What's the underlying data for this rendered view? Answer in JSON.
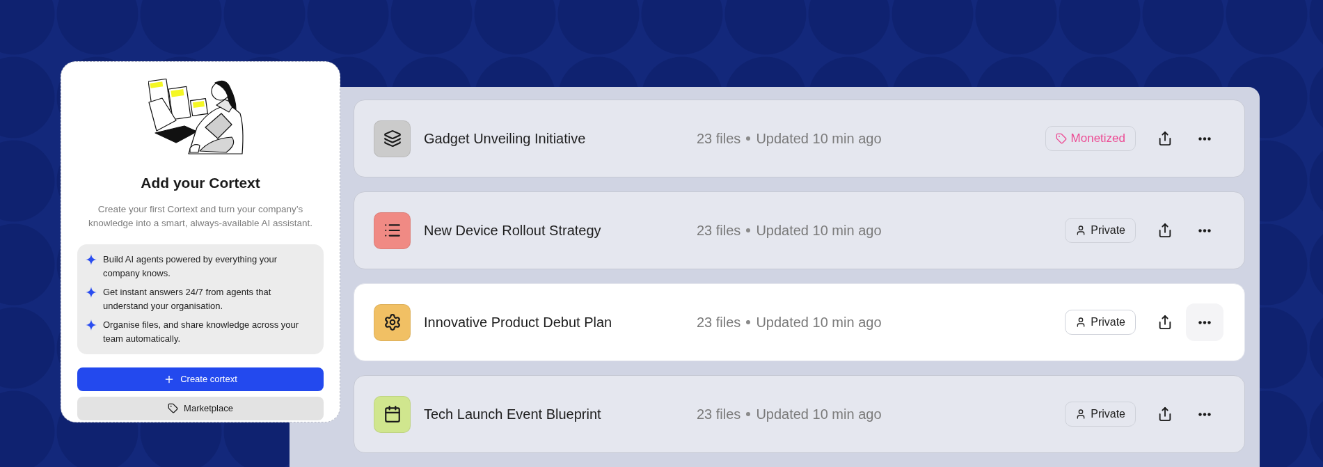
{
  "intro_card": {
    "title": "Add your Cortext",
    "description": "Create your first Cortext and turn your company’s knowledge into a smart, always-available AI assistant.",
    "features": [
      "Build AI agents powered by everything your company knows.",
      "Get instant answers 24/7 from agents that understand your organisation.",
      "Organise files, and share knowledge across your team automatically."
    ],
    "primary_button": "Create cortext",
    "secondary_button": "Marketplace"
  },
  "cortexts": [
    {
      "name": "Gadget Unveiling Initiative",
      "kind": "layers",
      "color": "#cbcbcb",
      "files": "23 files",
      "updated": "Updated 10 min ago",
      "badge": {
        "kind": "monetized",
        "label": "Monetized"
      },
      "selected": false
    },
    {
      "name": "New Device Rollout Strategy",
      "kind": "list",
      "color": "#f08a84",
      "files": "23 files",
      "updated": "Updated 10 min ago",
      "badge": {
        "kind": "private",
        "label": "Private"
      },
      "selected": false
    },
    {
      "name": "Innovative Product Debut Plan",
      "kind": "gear",
      "color": "#f1c064",
      "files": "23 files",
      "updated": "Updated 10 min ago",
      "badge": {
        "kind": "private",
        "label": "Private"
      },
      "selected": true
    },
    {
      "name": "Tech Launch Event Blueprint",
      "kind": "calendar",
      "color": "#d0e68e",
      "files": "23 files",
      "updated": "Updated 10 min ago",
      "badge": {
        "kind": "private",
        "label": "Private"
      },
      "selected": false
    }
  ]
}
